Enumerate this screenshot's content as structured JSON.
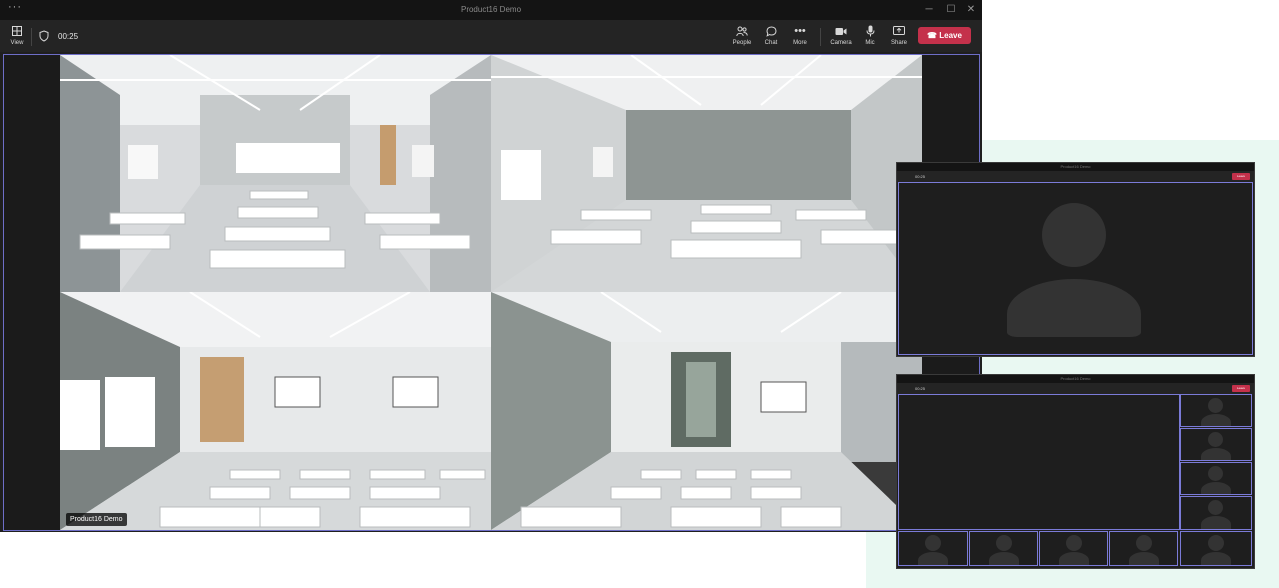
{
  "window": {
    "title": "Product16 Demo",
    "menu_icon": "more-dots-icon"
  },
  "toolbar": {
    "view_label": "View",
    "timer": "00:25",
    "people_label": "People",
    "chat_label": "Chat",
    "more_label": "More",
    "camera_label": "Camera",
    "mic_label": "Mic",
    "share_label": "Share",
    "leave_label": "Leave"
  },
  "stage": {
    "participant_name": "Product16 Demo"
  },
  "colors": {
    "leave": "#c4314b",
    "tile_border": "#7b7bd8",
    "mint": "#e9f8f2",
    "bg": "#1f1f1f"
  },
  "mini_windows": [
    {
      "title": "Product16 Demo",
      "timer": "00:25",
      "leave_label": "Leave"
    },
    {
      "title": "Product16 Demo",
      "timer": "00:25",
      "leave_label": "Leave"
    }
  ]
}
